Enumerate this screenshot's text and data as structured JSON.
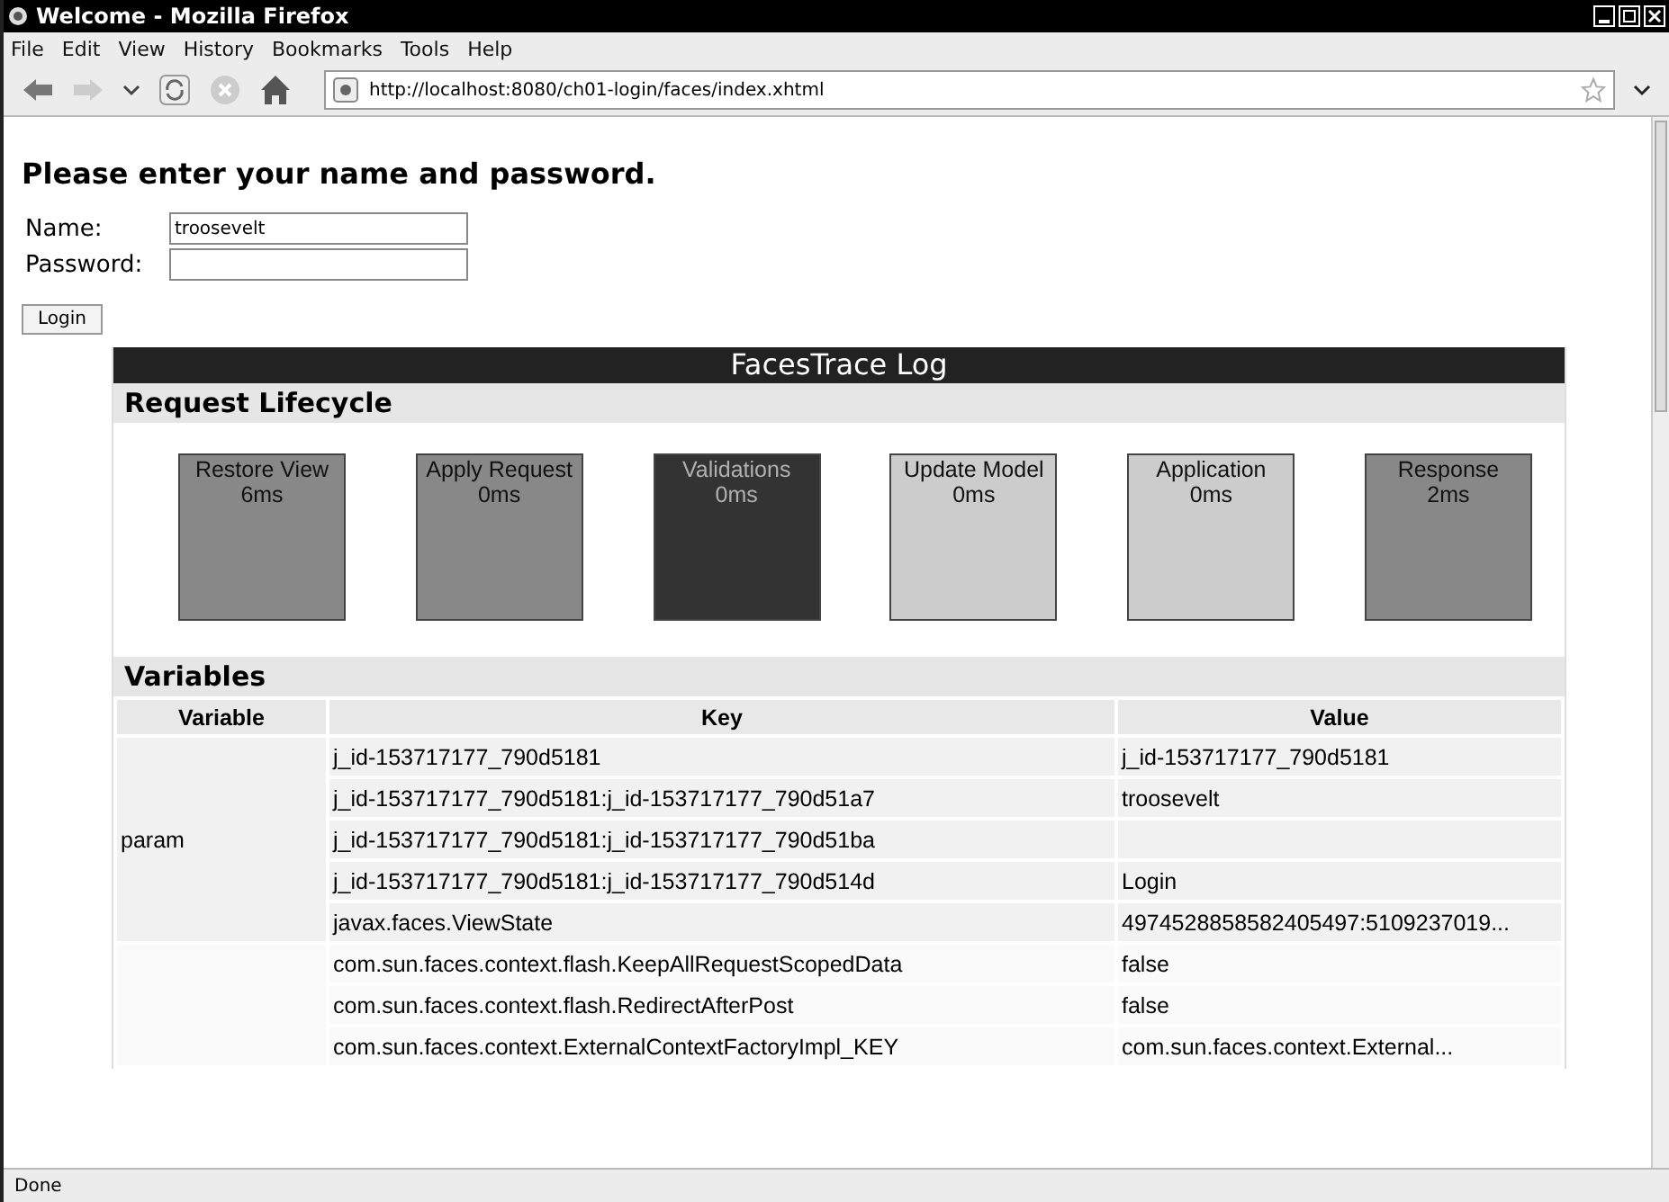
{
  "window": {
    "title": "Welcome - Mozilla Firefox"
  },
  "menu_bar": [
    "File",
    "Edit",
    "View",
    "History",
    "Bookmarks",
    "Tools",
    "Help"
  ],
  "toolbar": {
    "address": "http://localhost:8080/ch01-login/faces/index.xhtml"
  },
  "page": {
    "heading": "Please enter your name and password.",
    "fields": [
      {
        "label": "Name:",
        "value": "troosevelt"
      },
      {
        "label": "Password:"
      }
    ],
    "button": "Login"
  },
  "trace_log": {
    "title": "FacesTrace Log",
    "lifecycle_title": "Request Lifecycle",
    "phases": [
      {
        "name": "Restore View",
        "time": "6ms",
        "color": "#888888"
      },
      {
        "name": "Apply Request",
        "time": "0ms",
        "color": "#888888"
      },
      {
        "name": "Validations",
        "time": "0ms",
        "color": "#333333"
      },
      {
        "name": "Update Model",
        "time": "0ms",
        "color": "#cccccc"
      },
      {
        "name": "Application",
        "time": "0ms",
        "color": "#cccccc"
      },
      {
        "name": "Response",
        "time": "2ms",
        "color": "#888888"
      }
    ],
    "variables_title": "Variables",
    "columns": [
      "Variable",
      "Key",
      "Value"
    ],
    "groups": [
      {
        "variable": "param",
        "entries": [
          {
            "key": "j_id-153717177_790d5181",
            "value": "j_id-153717177_790d5181"
          },
          {
            "key": "j_id-153717177_790d5181:j_id-153717177_790d51a7",
            "value": "troosevelt"
          },
          {
            "key": "j_id-153717177_790d5181:j_id-153717177_790d51ba"
          },
          {
            "key": "j_id-153717177_790d5181:j_id-153717177_790d514d",
            "value": "Login"
          },
          {
            "key": "javax.faces.ViewState",
            "value": "4974528858582405497:5109237019..."
          }
        ]
      },
      {
        "entries": [
          {
            "key": "com.sun.faces.context.flash.KeepAllRequestScopedData",
            "value": "false"
          },
          {
            "key": "com.sun.faces.context.flash.RedirectAfterPost",
            "value": "false"
          },
          {
            "key": "com.sun.faces.context.ExternalContextFactoryImpl_KEY",
            "value": "com.sun.faces.context.External..."
          }
        ]
      }
    ]
  },
  "status_bar": "Done"
}
